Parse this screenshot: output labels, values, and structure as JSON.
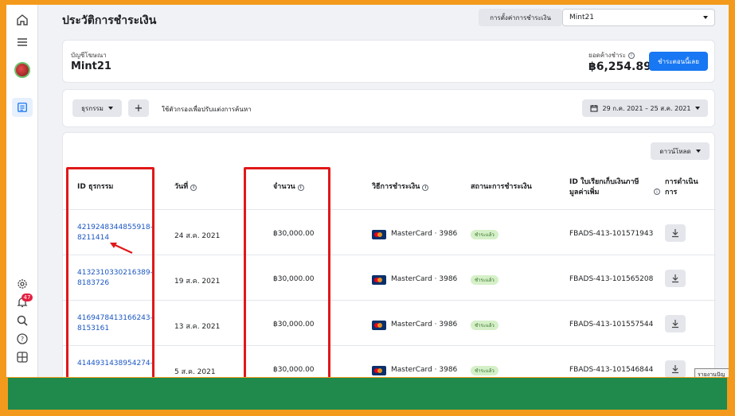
{
  "header": {
    "title": "ประวัติการชำระเงิน",
    "settings_label": "การตั้งค่าการชำระเงิน",
    "account_selector": "Mint21"
  },
  "account": {
    "label": "บัญชีโฆษณา",
    "name": "Mint21",
    "balance_label": "ยอดค้างชำระ",
    "balance": "฿6,254.89",
    "pay_now_label": "ชำระตอนนี้เลย"
  },
  "filters": {
    "type_label": "ธุรกรรม",
    "plus": "+",
    "hint": "ใช้ตัวกรองเพื่อปรับแต่งการค้นหา",
    "date_range": "29 ก.ค. 2021 – 25 ส.ค. 2021"
  },
  "table": {
    "download_label": "ดาวน์โหลด",
    "columns": {
      "id": "ID ธุรกรรม",
      "date": "วันที่",
      "amount": "จำนวน",
      "method": "วิธีการชำระเงิน",
      "status": "สถานะการชำระเงิน",
      "invoice_line1": "ID ใบเรียกเก็บเงินภาษี",
      "invoice_line2": "มูลค่าเพิ่ม",
      "action_line1": "การดำเนิน",
      "action_line2": "การ"
    },
    "rows": [
      {
        "id_line1": "4219248344855918-",
        "id_line2": "8211414",
        "date": "24 ส.ค. 2021",
        "amount": "฿30,000.00",
        "method": "MasterCard · 3986",
        "status": "ชำระแล้ว",
        "invoice": "FBADS-413-101571943"
      },
      {
        "id_line1": "4132310330216389-",
        "id_line2": "8183726",
        "date": "19 ส.ค. 2021",
        "amount": "฿30,000.00",
        "method": "MasterCard · 3986",
        "status": "ชำระแล้ว",
        "invoice": "FBADS-413-101565208"
      },
      {
        "id_line1": "4169478413166243-",
        "id_line2": "8153161",
        "date": "13 ส.ค. 2021",
        "amount": "฿30,000.00",
        "method": "MasterCard · 3986",
        "status": "ชำระแล้ว",
        "invoice": "FBADS-413-101557544"
      },
      {
        "id_line1": "4144931438954274-",
        "id_line2": "",
        "date": "5 ส.ค. 2021",
        "amount": "฿30,000.00",
        "method": "MasterCard · 3986",
        "status": "ชำระแล้ว",
        "invoice": "FBADS-413-101546844"
      }
    ]
  },
  "sidebar": {
    "notification_count": "47",
    "icons": [
      "home-icon",
      "menu-icon",
      "avatar",
      "billing-icon",
      "settings-icon",
      "notifications-icon",
      "search-icon",
      "help-icon",
      "panel-icon"
    ]
  },
  "tooltip": "รายงานปัญ",
  "colors": {
    "accent": "#1877f2",
    "annotation": "#e01818",
    "frame": "#f39a1c",
    "bottom_bar": "#1f8a4c"
  }
}
